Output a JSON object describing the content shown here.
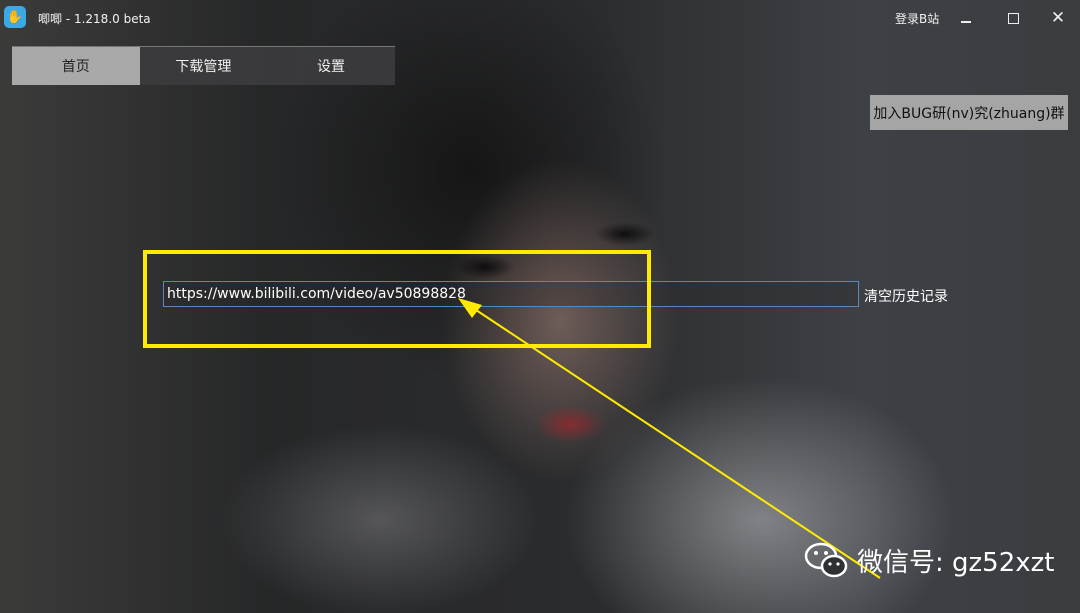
{
  "window": {
    "title": "唧唧 - 1.218.0 beta",
    "login_label": "登录B站"
  },
  "tabs": [
    {
      "label": "首页",
      "active": true
    },
    {
      "label": "下载管理",
      "active": false
    },
    {
      "label": "设置",
      "active": false
    }
  ],
  "bug_group_button": "加入BUG研(nv)究(zhuang)群",
  "url_input": {
    "value": "https://www.bilibili.com/video/av50898828"
  },
  "clear_history_label": "清空历史记录",
  "watermark": {
    "text": "微信号: gz52xzt"
  },
  "colors": {
    "highlight": "#ffeb00",
    "active_tab": "#a9a9a9",
    "input_border": "#5a86b8"
  }
}
